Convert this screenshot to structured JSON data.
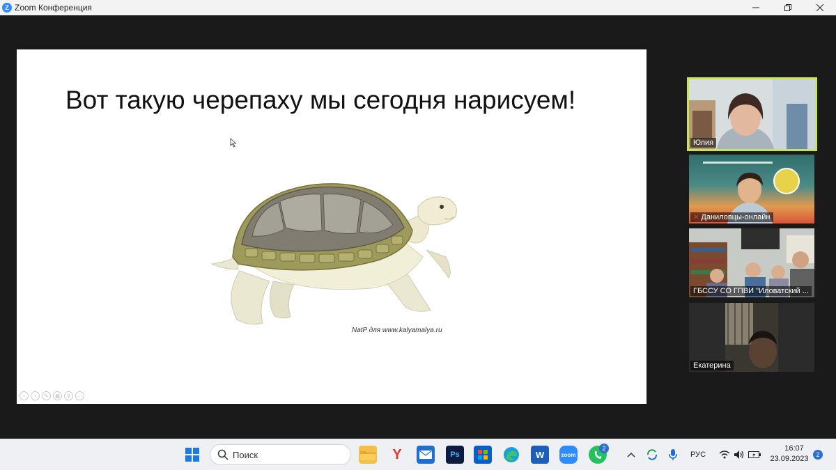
{
  "window": {
    "title": "Zoom Конференция"
  },
  "slide": {
    "title": "Вот такую черепаху мы сегодня нарисуем!",
    "credit": "NatP для www.kalyamalya.ru"
  },
  "participants": [
    {
      "name": "Юлия",
      "active": true
    },
    {
      "name": "Даниловцы-онлайн",
      "muted": true
    },
    {
      "name": "ГБССУ СО ГПВИ \"Иловатский ..."
    },
    {
      "name": "Екатерина"
    }
  ],
  "taskbar": {
    "search_label": "Поиск",
    "whatsapp_badge": "2",
    "language": "РУС",
    "time": "16:07",
    "date": "23.09.2023",
    "notification_count": "2"
  },
  "colors": {
    "active_speaker_border": "#c8e45a",
    "zoom_blue": "#2d8cff",
    "muted_red": "#e0443a"
  }
}
